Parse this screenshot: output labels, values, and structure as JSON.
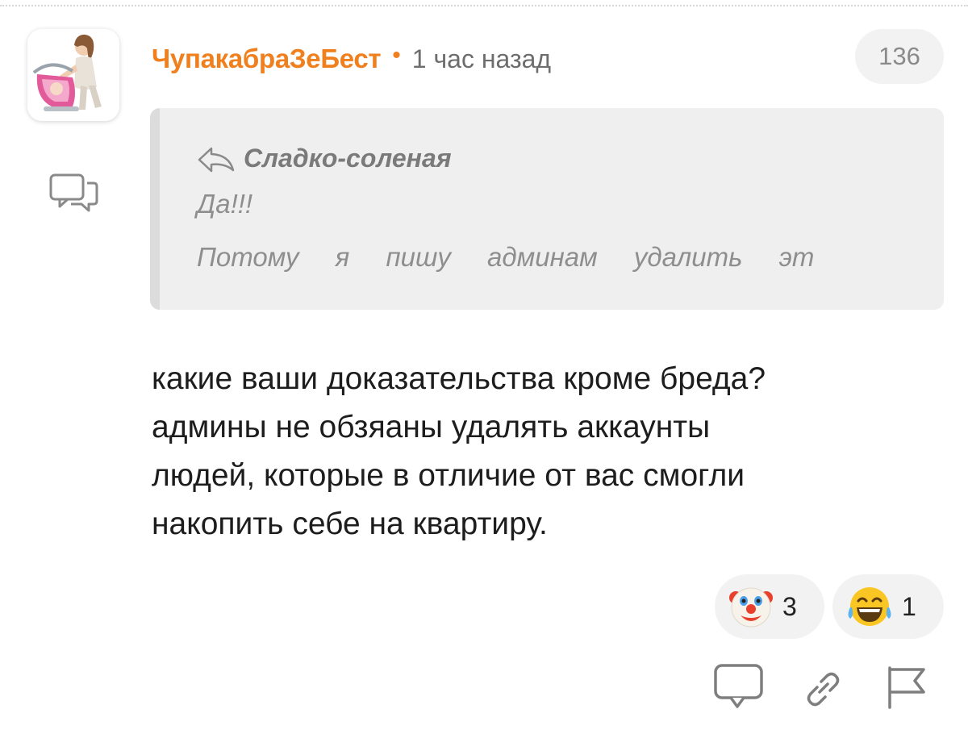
{
  "comment": {
    "author": "ЧупакабраЗеБест",
    "separator": "•",
    "time": "1 час назад",
    "count": "136",
    "quote": {
      "author": "Сладко-соленая",
      "line1": "Да!!!",
      "line2": "Потому я пишу админам удалить эт"
    },
    "body_lines": [
      "какие ваши доказательства кроме бреда?",
      "админы не обзяаны удалять аккаунты",
      "людей, которые в отличие от вас смогли",
      "накопить себе на квартиру."
    ],
    "reactions": [
      {
        "icon": "clown-face-emoji",
        "count": "3"
      },
      {
        "icon": "laughing-tears-emoji",
        "count": "1"
      }
    ]
  },
  "icons": {
    "side_reply": "chat-bubbles-icon",
    "quote_reply": "reply-arrow-icon",
    "action_reply": "comment-icon",
    "action_link": "link-icon",
    "action_report": "flag-icon"
  },
  "colors": {
    "author": "#f07f1d",
    "quote_bg": "#efefef",
    "badge_bg": "#f2f2f2"
  }
}
